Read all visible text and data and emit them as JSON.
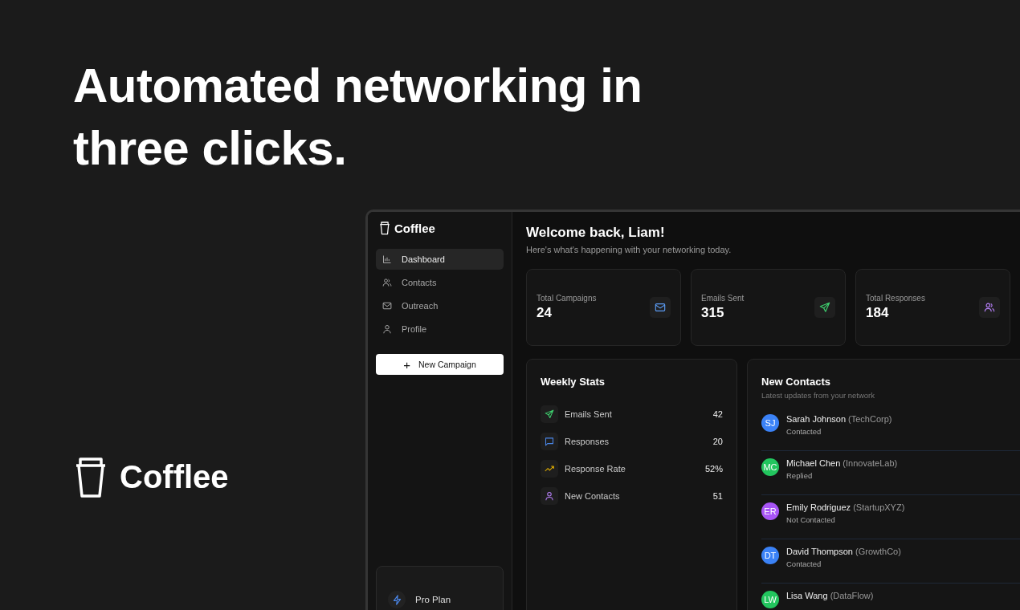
{
  "headline": "Automated networking in three clicks.",
  "brand": {
    "name": "Cofflee"
  },
  "app": {
    "sidebar": {
      "logo": "Cofflee",
      "items": [
        {
          "label": "Dashboard",
          "kind": "chart",
          "selected": true
        },
        {
          "label": "Contacts",
          "kind": "users",
          "selected": false
        },
        {
          "label": "Outreach",
          "kind": "mail",
          "selected": false
        },
        {
          "label": "Profile",
          "kind": "user",
          "selected": false
        }
      ],
      "new_button": {
        "icon": "+",
        "label": "New Campaign"
      },
      "plan": {
        "label": "Pro Plan"
      }
    },
    "greeting": {
      "title": "Welcome back, Liam!",
      "subtitle": "Here's what's happening with your networking today."
    },
    "stats": [
      {
        "label": "Total Campaigns",
        "value": "24",
        "kind": "mail"
      },
      {
        "label": "Emails Sent",
        "value": "315",
        "kind": "send"
      },
      {
        "label": "Total Responses",
        "value": "184",
        "kind": "users"
      }
    ],
    "weekly_stats": {
      "title": "Weekly Stats",
      "rows": [
        {
          "label": "Emails Sent",
          "value": "42",
          "kind": "send"
        },
        {
          "label": "Responses",
          "value": "20",
          "kind": "message"
        },
        {
          "label": "Response Rate",
          "value": "52%",
          "kind": "trend"
        },
        {
          "label": "New Contacts",
          "value": "51",
          "kind": "user"
        }
      ]
    },
    "new_contacts": {
      "title": "New Contacts",
      "subtitle": "Latest updates from your network",
      "items": [
        {
          "initials": "SJ",
          "name": "Sarah Johnson",
          "company": "(TechCorp)",
          "status": "Contacted",
          "color": "#3b82f6"
        },
        {
          "initials": "MC",
          "name": "Michael Chen",
          "company": "(InnovateLab)",
          "status": "Replied",
          "color": "#22c55e"
        },
        {
          "initials": "ER",
          "name": "Emily Rodriguez",
          "company": "(StartupXYZ)",
          "status": "Not Contacted",
          "color": "#a855f7"
        },
        {
          "initials": "DT",
          "name": "David Thompson",
          "company": "(GrowthCo)",
          "status": "Contacted",
          "color": "#3b82f6"
        },
        {
          "initials": "LW",
          "name": "Lisa Wang",
          "company": "(DataFlow)",
          "color": "#22c55e"
        }
      ]
    }
  }
}
